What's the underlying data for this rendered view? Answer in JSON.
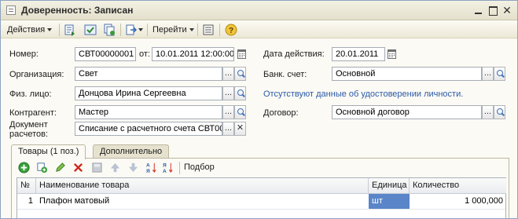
{
  "window": {
    "title": "Доверенность: Записан"
  },
  "toolbar": {
    "actions_label": "Действия",
    "goto_label": "Перейти"
  },
  "form": {
    "number_label": "Номер:",
    "number_value": "СВТ00000001",
    "date_from_label": "от:",
    "date_from_value": "10.01.2011 12:00:00",
    "valid_date_label": "Дата действия:",
    "valid_date_value": "20.01.2011",
    "org_label": "Организация:",
    "org_value": "Свет",
    "bank_label": "Банк. счет:",
    "bank_value": "Основной",
    "person_label": "Физ. лицо:",
    "person_value": "Донцова Ирина Сергеевна",
    "identity_notice": "Отсутствуют данные об удостоверении личности.",
    "contractor_label": "Контрагент:",
    "contractor_value": "Мастер",
    "contract_label": "Договор:",
    "contract_value": "Основной договор",
    "payment_doc_label_1": "Документ",
    "payment_doc_label_2": "расчетов:",
    "payment_doc_value": "Списание с расчетного счета СВТ00"
  },
  "tabs": [
    {
      "label": "Товары (1 поз.)"
    },
    {
      "label": "Дополнительно"
    }
  ],
  "goods_toolbar": {
    "selection_label": "Подбор"
  },
  "table": {
    "columns": [
      "№",
      "Наименование товара",
      "Единица",
      "Количество"
    ],
    "rows": [
      {
        "num": "1",
        "name": "Плафон матовый",
        "unit": "шт",
        "qty": "1 000,000"
      }
    ]
  },
  "colors": {
    "accent_link": "#2c5aa8",
    "selected_cell": "#5a86c9"
  }
}
